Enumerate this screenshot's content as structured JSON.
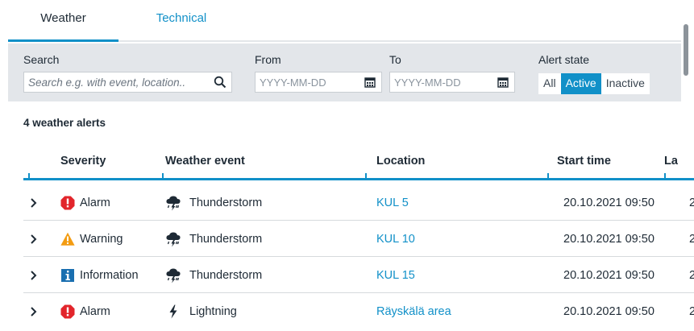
{
  "tabs": [
    {
      "label": "Weather",
      "active": true
    },
    {
      "label": "Technical",
      "active": false
    }
  ],
  "filters": {
    "search": {
      "label": "Search",
      "placeholder": "Search e.g. with event, location.."
    },
    "from": {
      "label": "From",
      "placeholder": "YYYY-MM-DD"
    },
    "to": {
      "label": "To",
      "placeholder": "YYYY-MM-DD"
    },
    "alert_state": {
      "label": "Alert state",
      "options": [
        "All",
        "Active",
        "Inactive"
      ],
      "selected": "Active"
    }
  },
  "summary": {
    "count_text": "4 weather alerts"
  },
  "table": {
    "headers": [
      "Severity",
      "Weather event",
      "Location",
      "Start time",
      "La"
    ],
    "rows": [
      {
        "severity": "Alarm",
        "severity_icon": "alarm-icon",
        "event": "Thunderstorm",
        "event_icon": "thunderstorm-icon",
        "location": "KUL 5",
        "start": "20.10.2021 09:50",
        "last": "2"
      },
      {
        "severity": "Warning",
        "severity_icon": "warning-icon",
        "event": "Thunderstorm",
        "event_icon": "thunderstorm-icon",
        "location": "KUL 10",
        "start": "20.10.2021 09:50",
        "last": "2"
      },
      {
        "severity": "Information",
        "severity_icon": "information-icon",
        "event": "Thunderstorm",
        "event_icon": "thunderstorm-icon",
        "location": "KUL 15",
        "start": "20.10.2021 09:50",
        "last": "2"
      },
      {
        "severity": "Alarm",
        "severity_icon": "alarm-icon",
        "event": "Lightning",
        "event_icon": "lightning-icon",
        "location": "Räyskälä area",
        "start": "20.10.2021 09:50",
        "last": "2"
      }
    ]
  },
  "colors": {
    "accent": "#1190c8",
    "alarm": "#e2252b",
    "warning": "#f39c12",
    "information": "#1a6fb0",
    "filter_bg": "#e3e6ea"
  }
}
